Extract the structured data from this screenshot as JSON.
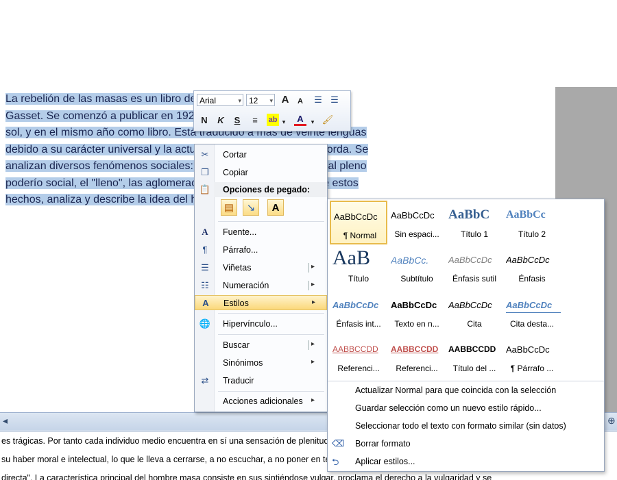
{
  "document": {
    "lines": [
      "La rebelión de las masas es un libro de ensayos de José Ortega y",
      "Gasset. Se comenzó a publicar en 1929 como artículos en el diario El",
      "sol, y en el mismo año como libro. Está traducido a más de veinte lenguas",
      "debido a su carácter universal y la actualidad de los temas que aborda. Se",
      "analizan diversos fenómenos sociales: la ascensión de las masas al pleno",
      "poderío social, el \"lleno\", las aglomeraciones, la gente y a partir de estos",
      "hechos, analiza y describe la idea del hombre masa."
    ],
    "bottom_lines": [
      "es trágicas. Por tanto cada individuo medio encuentra en sí una sensación de plenitud y se siente satisfecho de sí mismo, se siente perfecto y no",
      " su haber moral e intelectual, lo que le lleva a cerrarse, a no escuchar, a no poner en tela de juicio sus opiniones y a no contar con los demás si",
      " directa\". La característica principal del hombre masa consiste en sus sintiéndose vulgar, proclama el derecho a la vulgaridad y se"
    ]
  },
  "mini_toolbar": {
    "font_name": "Arial",
    "font_size": "12",
    "grow_font": "A",
    "shrink_font": "A",
    "bold": "N",
    "italic": "K",
    "underline": "S",
    "highlight": "ab",
    "font_color": "A"
  },
  "context_menu": {
    "cut": "Cortar",
    "copy": "Copiar",
    "paste_options": "Opciones de pegado:",
    "paste_keep_text": "A",
    "font": "Fuente...",
    "paragraph": "Párrafo...",
    "bullets": "Viñetas",
    "numbering": "Numeración",
    "styles": "Estilos",
    "hyperlink": "Hipervínculo...",
    "search": "Buscar",
    "synonyms": "Sinónimos",
    "translate": "Traducir",
    "additional_actions": "Acciones adicionales",
    "submenu_glyph": "▸"
  },
  "styles_gallery": {
    "tiles": [
      {
        "preview": "AaBbCcDc",
        "name": "¶ Normal"
      },
      {
        "preview": "AaBbCcDc",
        "name": "Sin espaci..."
      },
      {
        "preview": "AaBbC",
        "name": "Título 1"
      },
      {
        "preview": "AaBbCc",
        "name": "Título 2"
      },
      {
        "preview": "AaB",
        "name": "Título"
      },
      {
        "preview": "AaBbCc.",
        "name": "Subtítulo"
      },
      {
        "preview": "AaBbCcDc",
        "name": "Énfasis sutil"
      },
      {
        "preview": "AaBbCcDc",
        "name": "Énfasis"
      },
      {
        "preview": "AaBbCcDc",
        "name": "Énfasis int..."
      },
      {
        "preview": "AaBbCcDc",
        "name": "Texto en n..."
      },
      {
        "preview": "AaBbCcDc",
        "name": "Cita"
      },
      {
        "preview": "AaBbCcDc",
        "name": "Cita desta..."
      },
      {
        "preview": "AABBCCDD",
        "name": "Referenci..."
      },
      {
        "preview": "AABBCCDD",
        "name": "Referenci..."
      },
      {
        "preview": "AABBCCDD",
        "name": "Título del ..."
      },
      {
        "preview": "AaBbCcDc",
        "name": "¶ Párrafo ..."
      }
    ],
    "actions": {
      "update_normal": "Actualizar Normal para que coincida con la selección",
      "save_quick_style": "Guardar selección como un nuevo estilo rápido...",
      "select_similar": "Seleccionar todo el texto con formato similar (sin datos)",
      "clear_formatting": "Borrar formato",
      "apply_styles": "Aplicar estilos..."
    }
  },
  "colors": {
    "selection": "#b4cde9",
    "heading_blue": "#365f91",
    "heading2_blue": "#4f81bd",
    "accent_red": "#c0504d",
    "menu_highlight": "#fbd87a"
  },
  "icons": {
    "cut": "scissors-icon",
    "copy": "copy-icon",
    "paste": "clipboard-icon",
    "font": "font-icon",
    "paragraph": "paragraph-icon",
    "bullets": "bullets-icon",
    "numbering": "numbering-icon",
    "styles": "styles-icon",
    "hyperlink": "globe-link-icon",
    "translate": "translate-icon"
  }
}
